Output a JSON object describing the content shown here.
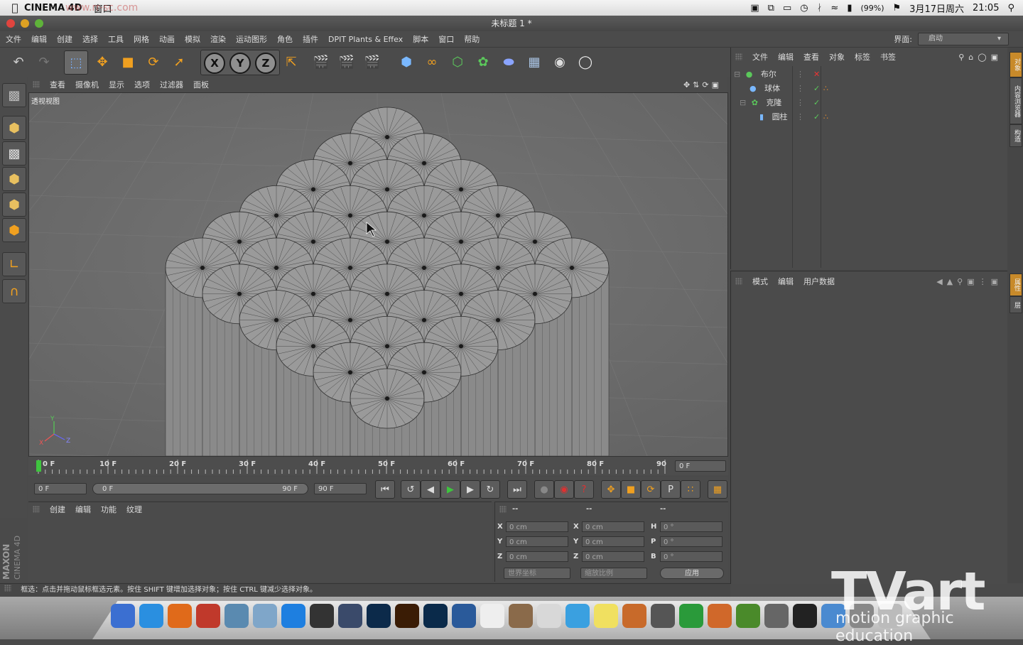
{
  "mac_menubar": {
    "app_name": "CINEMA 4D",
    "menu_window": "窗口",
    "battery": "(99%)",
    "date": "3月17日周六",
    "time": "21:05",
    "overlay_url": "www.rr-sc.com"
  },
  "window": {
    "title": "未标题 1 *"
  },
  "main_menu": {
    "items": [
      "文件",
      "编辑",
      "创建",
      "选择",
      "工具",
      "网格",
      "动画",
      "模拟",
      "渲染",
      "运动图形",
      "角色",
      "插件",
      "DPIT Plants & Effex",
      "脚本",
      "窗口",
      "帮助"
    ],
    "layout_label": "界面:",
    "layout_value": "启动"
  },
  "toolbar": {
    "axis_x": "X",
    "axis_y": "Y",
    "axis_z": "Z"
  },
  "viewport": {
    "menu": [
      "查看",
      "摄像机",
      "显示",
      "选项",
      "过滤器",
      "面板"
    ],
    "view_name": "透视视图",
    "axis_labels": {
      "x": "X",
      "y": "Y",
      "z": "Z"
    }
  },
  "timeline": {
    "ticks": [
      "0 F",
      "10 F",
      "20 F",
      "30 F",
      "40 F",
      "50 F",
      "60 F",
      "70 F",
      "80 F",
      "90"
    ],
    "current_frame": "0 F"
  },
  "transport": {
    "start_field": "0 F",
    "range_start": "0 F",
    "range_end": "90 F",
    "end_field": "90 F"
  },
  "material_panel": {
    "menu": [
      "创建",
      "编辑",
      "功能",
      "纹理"
    ]
  },
  "coord_panel": {
    "header_left": "--",
    "header_mid": "--",
    "header_right": "--",
    "rows": [
      {
        "l1": "X",
        "v1": "0 cm",
        "l2": "X",
        "v2": "0 cm",
        "l3": "H",
        "v3": "0 °"
      },
      {
        "l1": "Y",
        "v1": "0 cm",
        "l2": "Y",
        "v2": "0 cm",
        "l3": "P",
        "v3": "0 °"
      },
      {
        "l1": "Z",
        "v1": "0 cm",
        "l2": "Z",
        "v2": "0 cm",
        "l3": "B",
        "v3": "0 °"
      }
    ],
    "coord_mode": "世界坐标",
    "scale_mode": "缩放比例",
    "apply": "应用"
  },
  "object_manager": {
    "menu": [
      "文件",
      "编辑",
      "查看",
      "对象",
      "标签",
      "书签"
    ],
    "objects": [
      {
        "name": "布尔",
        "indent": 0
      },
      {
        "name": "球体",
        "indent": 1
      },
      {
        "name": "克隆",
        "indent": 1
      },
      {
        "name": "圆柱",
        "indent": 2
      }
    ]
  },
  "attribute_manager": {
    "menu": [
      "模式",
      "编辑",
      "用户数据"
    ]
  },
  "side_tabs": [
    "对象",
    "内容浏览器",
    "构造",
    "属性",
    "层"
  ],
  "status_bar": {
    "text": "框选：点击并拖动鼠标框选元素。按住 SHIFT 键增加选择对象；按住 CTRL 键减少选择对象。"
  },
  "maxon_logo": {
    "line1": "MAXON",
    "line2": "CINEMA 4D"
  },
  "dock": {
    "apps": [
      "Finder",
      "Safari",
      "Firefox",
      "Parallels",
      "iPhoto",
      "Preview",
      "App Store",
      "DVD",
      "AE",
      "Ps",
      "Ai",
      "Cinema 4D",
      "FontExplorer",
      "Inkscape",
      "Photo Browser",
      "Address",
      "iTunes",
      "Stickies",
      "Keynote",
      "Pen",
      "Numbers",
      "Pages",
      "Pages2",
      "Tool",
      "QQ",
      "Folder",
      "Printer",
      "Cloud"
    ]
  },
  "watermark": {
    "logo": "TVart",
    "tagline": "motion graphic education"
  },
  "colors": {
    "ui_bg": "#4b4b4b",
    "viewport_bg": "#6d6d6d",
    "accent_orange": "#f0a020",
    "play_green": "#3ec43e"
  }
}
